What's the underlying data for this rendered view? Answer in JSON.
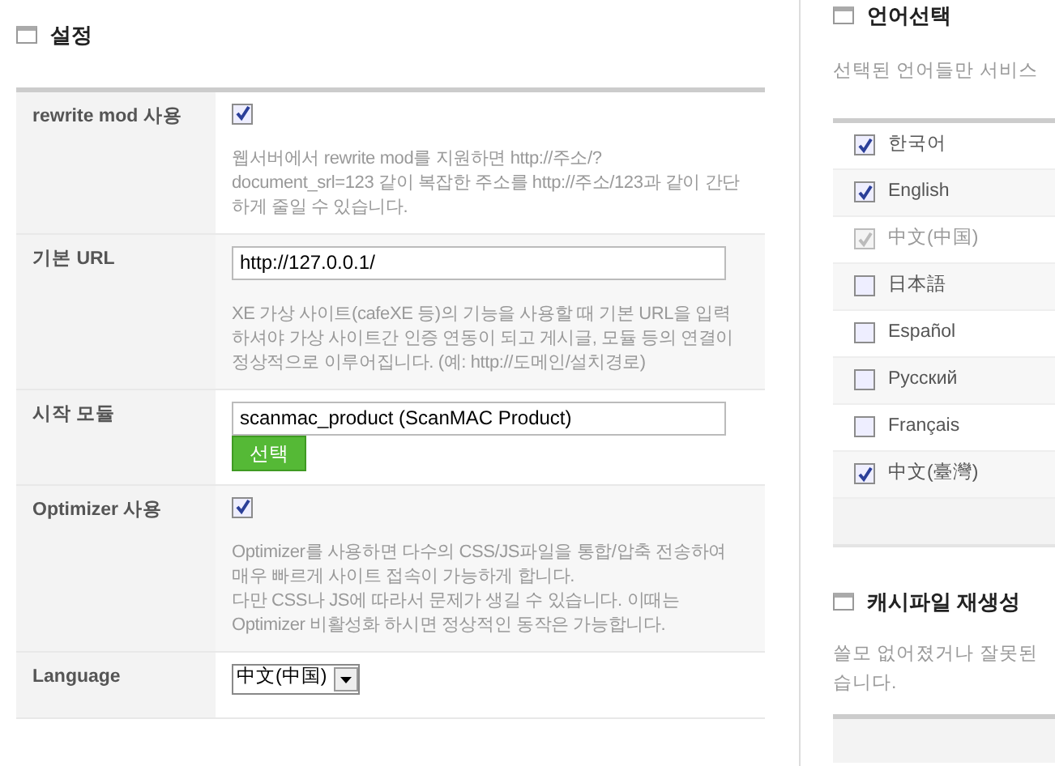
{
  "settings": {
    "title": "설정",
    "rows": [
      {
        "kind": "checkbox",
        "label": "rewrite mod 사용",
        "checked": true,
        "description": [
          "웹서버에서 rewrite mod를 지원하면 http://주소/?document_srl=123 같이 복잡한 주소를 http://주소/123과 같이 간단하게 줄일 수 있습니다."
        ]
      },
      {
        "kind": "text",
        "label": "기본 URL",
        "value": "http://127.0.0.1/",
        "description": [
          "XE 가상 사이트(cafeXE 등)의 기능을 사용할 때 기본 URL을 입력하셔야 가상 사이트간 인증 연동이 되고 게시글, 모듈 등의 연결이 정상적으로 이루어집니다. (예: http://도메인/설치경로)"
        ]
      },
      {
        "kind": "module",
        "label": "시작 모듈",
        "value": "scanmac_product (ScanMAC Product)",
        "button": "선택"
      },
      {
        "kind": "checkbox",
        "label": "Optimizer 사용",
        "checked": true,
        "description": [
          "Optimizer를 사용하면 다수의 CSS/JS파일을 통합/압축 전송하여 매우 빠르게 사이트 접속이 가능하게 합니다.",
          "다만 CSS나 JS에 따라서 문제가 생길 수 있습니다. 이때는 Optimizer 비활성화 하시면 정상적인 동작은 가능합니다."
        ]
      },
      {
        "kind": "select",
        "label": "Language",
        "value": "中文(中国)"
      }
    ]
  },
  "language_panel": {
    "title": "언어선택",
    "description": "선택된 언어들만 서비스",
    "languages": [
      {
        "label": "한국어",
        "checked": true,
        "disabled": false
      },
      {
        "label": "English",
        "checked": true,
        "disabled": false
      },
      {
        "label": "中文(中国)",
        "checked": true,
        "disabled": true
      },
      {
        "label": "日本語",
        "checked": false,
        "disabled": false
      },
      {
        "label": "Español",
        "checked": false,
        "disabled": false
      },
      {
        "label": "Русский",
        "checked": false,
        "disabled": false
      },
      {
        "label": "Français",
        "checked": false,
        "disabled": false
      },
      {
        "label": "中文(臺灣)",
        "checked": true,
        "disabled": false
      }
    ]
  },
  "cache_panel": {
    "title": "캐시파일 재생성",
    "description": [
      "쓸모 없어졌거나 잘못된",
      "습니다."
    ]
  }
}
